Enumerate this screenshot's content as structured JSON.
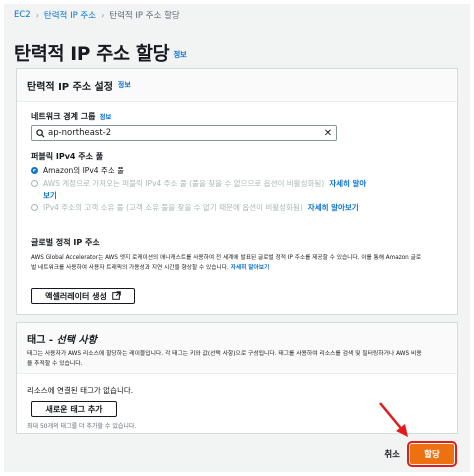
{
  "breadcrumb": {
    "items": [
      "EC2",
      "탄력적 IP 주소",
      "탄력적 IP 주소 할당"
    ]
  },
  "page": {
    "title": "탄력적 IP 주소 할당",
    "info": "정보"
  },
  "settings": {
    "title": "탄력적 IP 주소 설정",
    "info": "정보",
    "network_label": "네트워크 경계 그룹",
    "network_info": "정보",
    "network_value": "ap-northeast-2",
    "pool_label": "퍼블릭 IPv4 주소 풀",
    "options": [
      {
        "label": "Amazon의 IPv4 주소 풀",
        "selected": true
      },
      {
        "label": "AWS 계정으로 가져오는 퍼블릭 IPv4 주소 풀 (풀을 찾을 수 없으므로 옵션이 비활성화됨)",
        "link": "자세히 알아",
        "link2": "보기"
      },
      {
        "label": "IPv4 주소의 고객 소유 풀 (고객 소유 풀을 찾을 수 없기 때문에 옵션이 비활성화됨)",
        "link": "자세히 알아보기"
      }
    ],
    "global_label": "글로벌 정적 IP 주소",
    "global_desc_1": "AWS Global Accelerator는 AWS 엣지 로케이션의 애니캐스트를 사용하여 전 세계에 발표된 글로벌 정적 IP 주소를 제공할 수 있습니다. 이를 통해 Amazon 글로",
    "global_desc_2": "벌 네트워크를 사용하여 사용자 트래픽의 가용성과 지연 시간을 향상할 수 있습니다.",
    "global_link": "자세히 알아보기",
    "accelerator_button": "액셀러레이터 생성"
  },
  "tags": {
    "title": "태그 - ",
    "title_em": "선택 사항",
    "desc_1": "태그는 사용자가 AWS 리소스에 할당하는 레이블입니다. 각 태그는 키와 값(선택 사항)으로 구성됩니다. 태그를 사용하여 리소스를 검색 및 필터링하거나 AWS 비용",
    "desc_2": "을 추적할 수 있습니다.",
    "empty": "리소스에 연결된 태그가 없습니다.",
    "add_button": "새로운 태그 추가",
    "limit": "최대 50개의 태그를 더 추가할 수 있습니다."
  },
  "footer": {
    "cancel": "취소",
    "submit": "할당"
  },
  "colors": {
    "primary": "#ec7211",
    "link": "#0972d3",
    "highlight": "#e31b1b"
  }
}
